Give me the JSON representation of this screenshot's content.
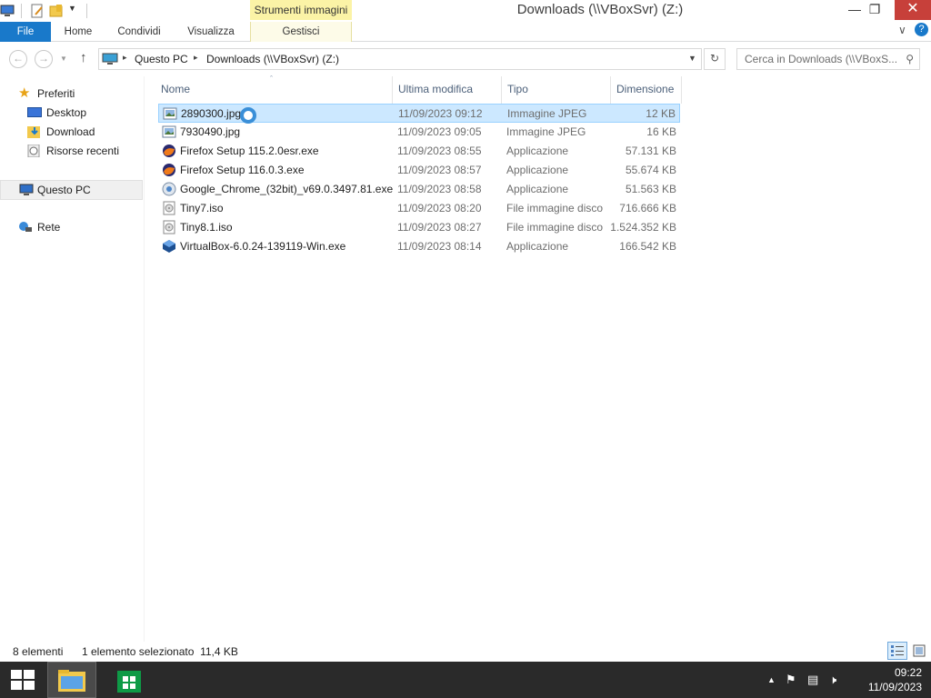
{
  "window": {
    "title": "Downloads (\\\\VBoxSvr) (Z:)",
    "context_tab_group": "Strumenti immagini",
    "minimize": "—",
    "restore": "❐",
    "close": "✕"
  },
  "ribbon": {
    "tabs": [
      {
        "label": "File"
      },
      {
        "label": "Home"
      },
      {
        "label": "Condividi"
      },
      {
        "label": "Visualizza"
      },
      {
        "label": "Gestisci"
      }
    ],
    "expand": "∨",
    "help": "?"
  },
  "address": {
    "breadcrumb": [
      "Questo PC",
      "Downloads (\\\\VBoxSvr) (Z:)"
    ],
    "search_placeholder": "Cerca in Downloads (\\\\VBoxS...",
    "separator": "▸"
  },
  "nav": {
    "favorites": "Preferiti",
    "desktop": "Desktop",
    "download": "Download",
    "recent": "Risorse recenti",
    "this_pc": "Questo PC",
    "network": "Rete"
  },
  "columns": {
    "name": "Nome",
    "modified": "Ultima modifica",
    "type": "Tipo",
    "size": "Dimensione"
  },
  "files": [
    {
      "name": "2890300.jpg",
      "modified": "11/09/2023 09:12",
      "type": "Immagine JPEG",
      "size": "12 KB",
      "icon": "image-file-icon"
    },
    {
      "name": "7930490.jpg",
      "modified": "11/09/2023 09:05",
      "type": "Immagine JPEG",
      "size": "16 KB",
      "icon": "image-file-icon"
    },
    {
      "name": "Firefox Setup 115.2.0esr.exe",
      "modified": "11/09/2023 08:55",
      "type": "Applicazione",
      "size": "57.131 KB",
      "icon": "firefox-icon"
    },
    {
      "name": "Firefox Setup 116.0.3.exe",
      "modified": "11/09/2023 08:57",
      "type": "Applicazione",
      "size": "55.674 KB",
      "icon": "firefox-icon"
    },
    {
      "name": "Google_Chrome_(32bit)_v69.0.3497.81.exe",
      "modified": "11/09/2023 08:58",
      "type": "Applicazione",
      "size": "51.563 KB",
      "icon": "installer-icon"
    },
    {
      "name": "Tiny7.iso",
      "modified": "11/09/2023 08:20",
      "type": "File immagine disco",
      "size": "716.666 KB",
      "icon": "disc-image-icon"
    },
    {
      "name": "Tiny8.1.iso",
      "modified": "11/09/2023 08:27",
      "type": "File immagine disco",
      "size": "1.524.352 KB",
      "icon": "disc-image-icon"
    },
    {
      "name": "VirtualBox-6.0.24-139119-Win.exe",
      "modified": "11/09/2023 08:14",
      "type": "Applicazione",
      "size": "166.542 KB",
      "icon": "virtualbox-icon"
    }
  ],
  "status": {
    "count": "8 elementi",
    "selection": "1 elemento selezionato  11,4 KB"
  },
  "taskbar": {
    "time": "09:22",
    "date": "11/09/2023"
  },
  "colors": {
    "accent": "#1979ca",
    "selection": "#cce8ff",
    "context_tab": "#fbf3a6",
    "close": "#c7403a",
    "taskbar": "#2a2a2a"
  }
}
